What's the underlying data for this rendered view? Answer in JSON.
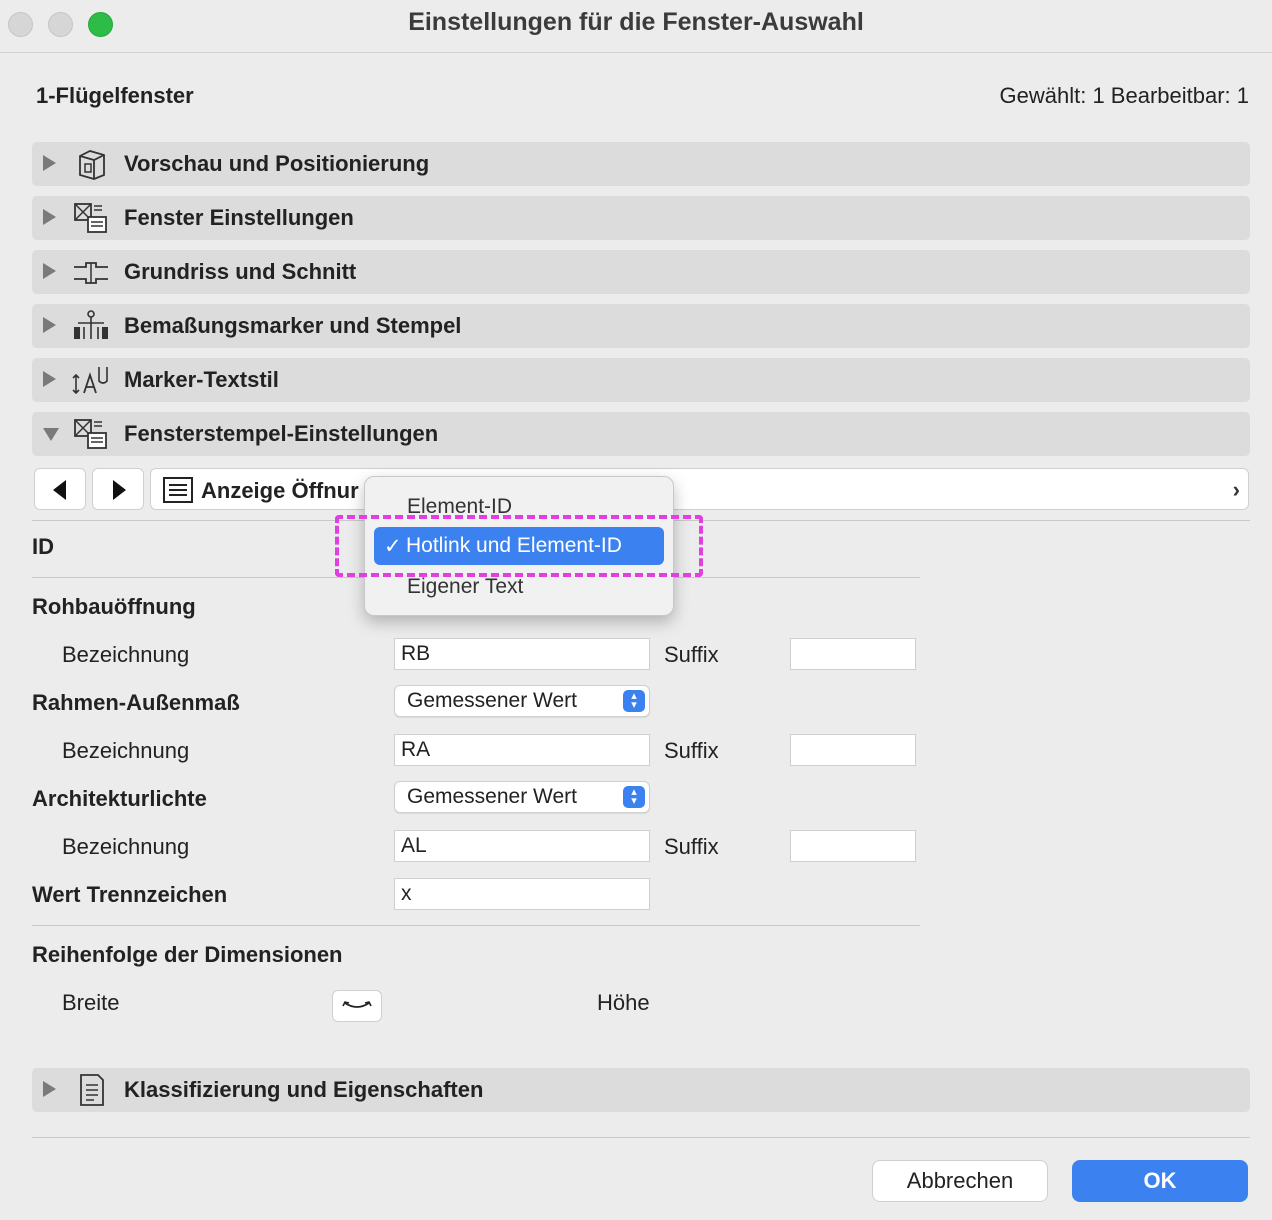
{
  "window": {
    "title": "Einstellungen für die Fenster-Auswahl"
  },
  "header": {
    "element_name": "1-Flügelfenster",
    "selection_info": "Gewählt: 1 Bearbeitbar: 1"
  },
  "sections": [
    {
      "label": "Vorschau und Positionierung",
      "icon": "preview-box-icon",
      "expanded": false
    },
    {
      "label": "Fenster Einstellungen",
      "icon": "window-settings-icon",
      "expanded": false
    },
    {
      "label": "Grundriss und Schnitt",
      "icon": "floorplan-section-icon",
      "expanded": false
    },
    {
      "label": "Bemaßungsmarker und Stempel",
      "icon": "dimension-marker-icon",
      "expanded": false
    },
    {
      "label": "Marker-Textstil",
      "icon": "text-style-icon",
      "expanded": false
    },
    {
      "label": "Fensterstempel-Einstellungen",
      "icon": "window-stamp-icon",
      "expanded": true
    },
    {
      "label": "Klassifizierung und Eigenschaften",
      "icon": "document-icon",
      "expanded": false
    }
  ],
  "panel_nav": {
    "page_label": "Anzeige Öffnur"
  },
  "form": {
    "id_label": "ID",
    "rohbau": {
      "label": "Rohbauöffnung",
      "bez_label": "Bezeichnung",
      "bez_value": "RB",
      "suffix_label": "Suffix",
      "suffix_value": ""
    },
    "rahmen": {
      "label": "Rahmen-Außenmaß",
      "select_value": "Gemessener Wert",
      "bez_label": "Bezeichnung",
      "bez_value": "RA",
      "suffix_label": "Suffix",
      "suffix_value": ""
    },
    "architektur": {
      "label": "Architekturlichte",
      "select_value": "Gemessener Wert",
      "bez_label": "Bezeichnung",
      "bez_value": "AL",
      "suffix_label": "Suffix",
      "suffix_value": ""
    },
    "trenn": {
      "label": "Wert Trennzeichen",
      "value": "x"
    },
    "reihenfolge": {
      "label": "Reihenfolge der Dimensionen",
      "left": "Breite",
      "right": "Höhe"
    }
  },
  "dropdown": {
    "options": [
      "Element-ID",
      "Hotlink und Element-ID",
      "Eigener Text"
    ],
    "selected": "Hotlink und Element-ID",
    "check": "✓"
  },
  "buttons": {
    "cancel": "Abbrechen",
    "ok": "OK"
  },
  "colors": {
    "accent": "#3b82f0",
    "annotation": "#e040e0"
  }
}
